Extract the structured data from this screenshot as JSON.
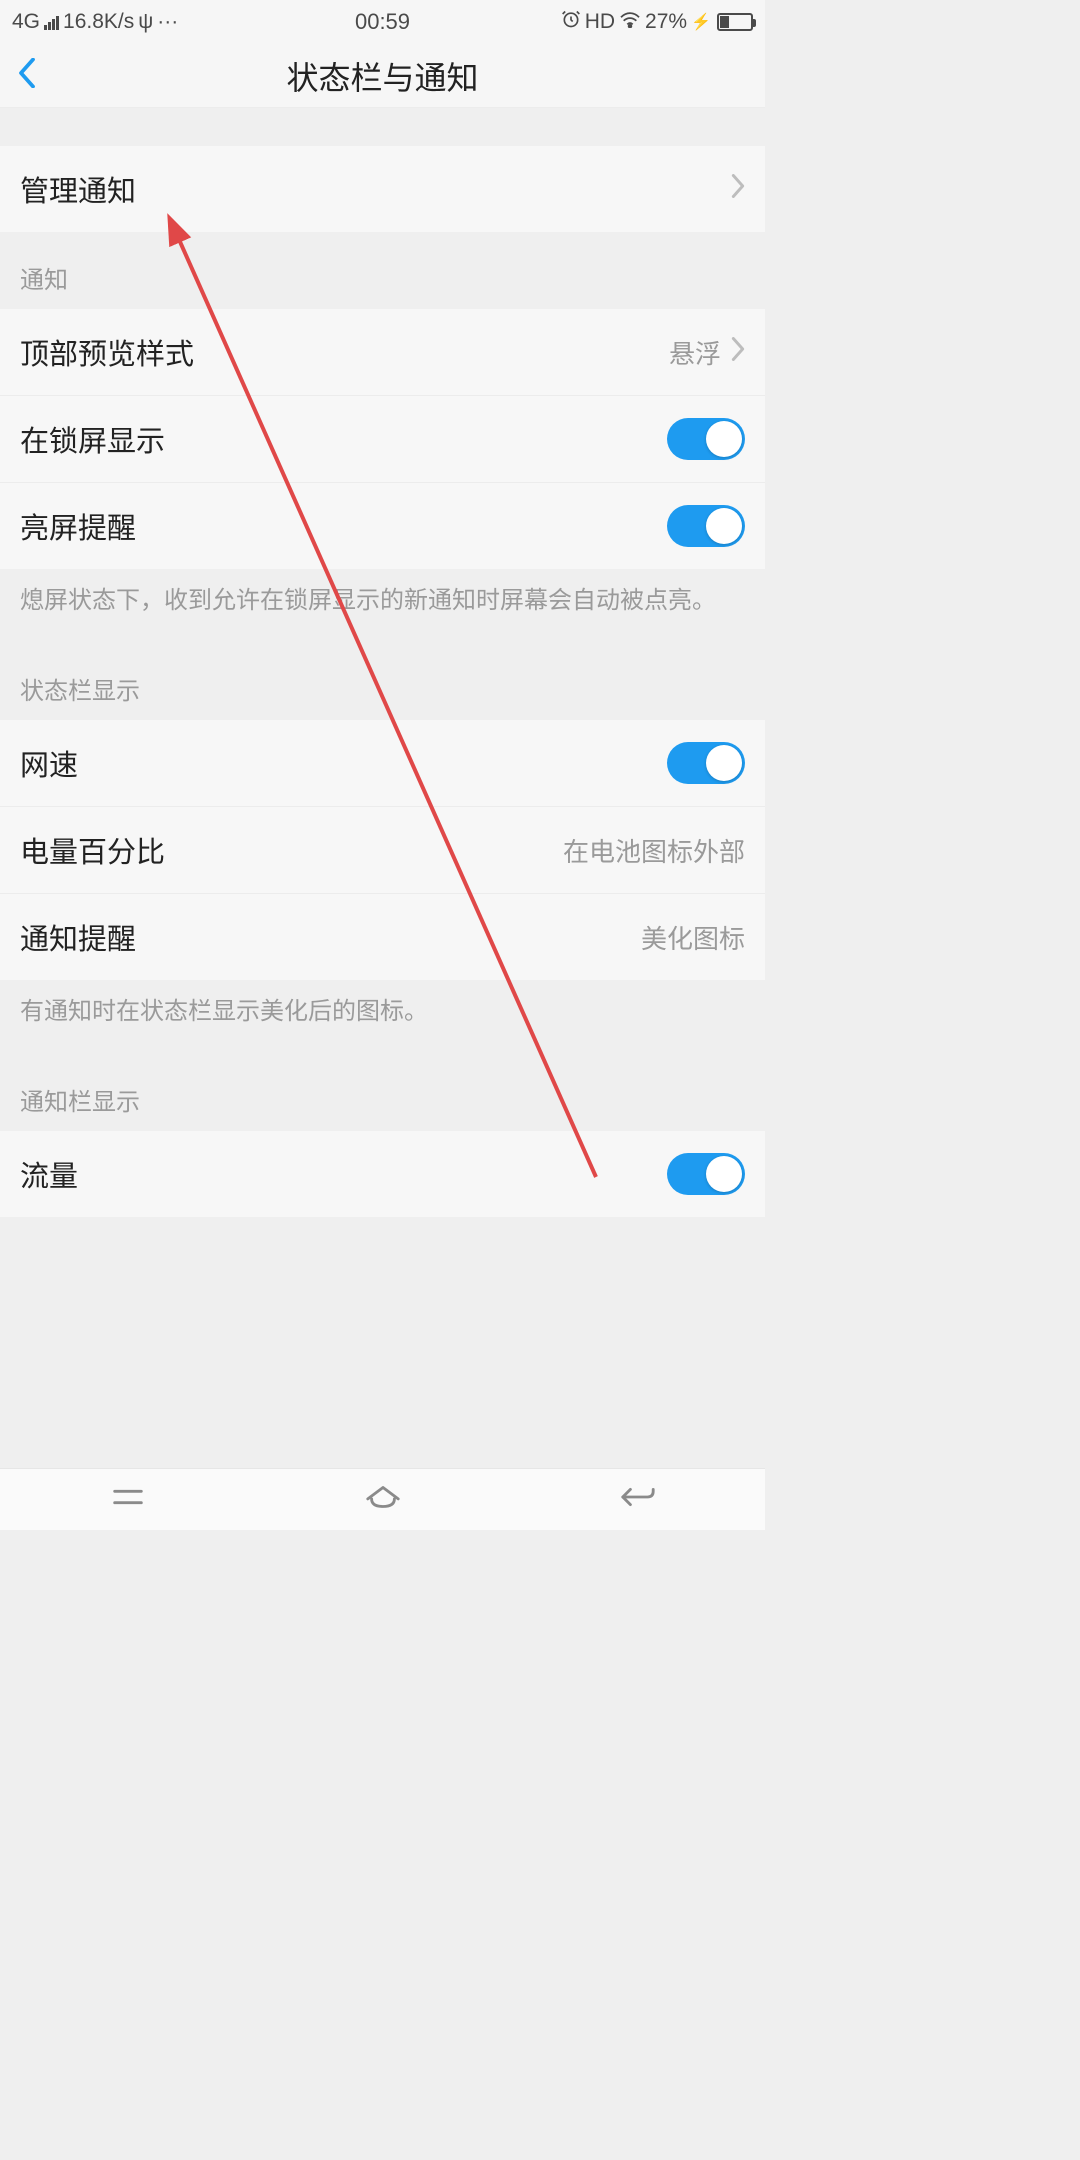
{
  "status": {
    "network": "4G",
    "speed": "16.8K/s",
    "usb": "⎋",
    "more": "···",
    "time": "00:59",
    "alarm": "⏰",
    "hd": "HD",
    "battery_pct": "27%"
  },
  "header": {
    "title": "状态栏与通知"
  },
  "rows": {
    "manage": {
      "label": "管理通知"
    },
    "section_notify": "通知",
    "preview_style": {
      "label": "顶部预览样式",
      "value": "悬浮"
    },
    "lock_screen": {
      "label": "在锁屏显示"
    },
    "wake_screen": {
      "label": "亮屏提醒"
    },
    "wake_footer": "熄屏状态下，收到允许在锁屏显示的新通知时屏幕会自动被点亮。",
    "section_statusbar": "状态栏显示",
    "net_speed": {
      "label": "网速"
    },
    "battery_pct_row": {
      "label": "电量百分比",
      "value": "在电池图标外部"
    },
    "notify_reminder": {
      "label": "通知提醒",
      "value": "美化图标"
    },
    "reminder_footer": "有通知时在状态栏显示美化后的图标。",
    "section_panel": "通知栏显示",
    "data_usage": {
      "label": "流量"
    }
  }
}
